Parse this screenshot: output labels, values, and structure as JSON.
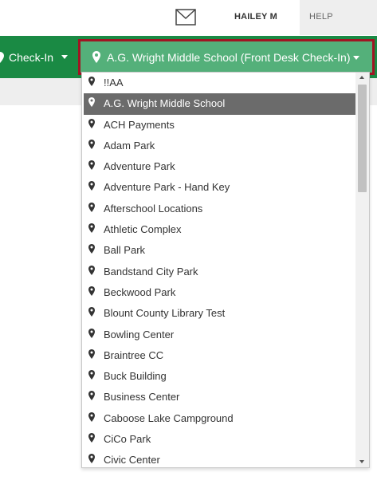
{
  "header": {
    "user_name": "HAILEY M",
    "help_label": "HELP",
    "mail_icon": "envelope-icon"
  },
  "nav": {
    "checkin_label": "Check-In",
    "location_button_label": "A.G. Wright Middle School (Front Desk Check-In)"
  },
  "colors": {
    "nav_green": "#1a8a44",
    "button_green": "#54b07a",
    "highlight_border": "#a01523",
    "selected_row": "#6b6b6b"
  },
  "location_dropdown": {
    "selected": "A.G. Wright Middle School",
    "items": [
      "!!AA",
      "A.G. Wright Middle School",
      "ACH Payments",
      "Adam Park",
      "Adventure Park",
      "Adventure Park - Hand Key",
      "Afterschool Locations",
      "Athletic Complex",
      "Ball Park",
      "Bandstand City Park",
      "Beckwood Park",
      "Blount County Library Test",
      "Bowling Center",
      "Braintree CC",
      "Buck Building",
      "Business Center",
      "Caboose Lake Campground",
      "CiCo Park",
      "Civic Center"
    ]
  }
}
